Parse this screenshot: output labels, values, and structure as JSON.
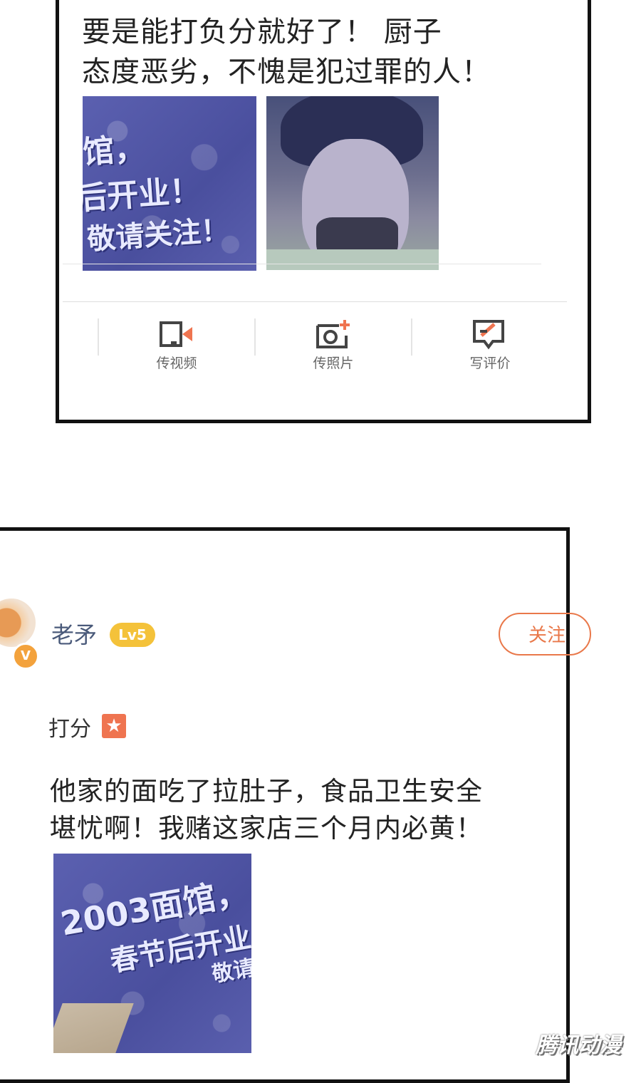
{
  "top_panel": {
    "review_text": "要是能打负分就好了！ 厨子\n态度恶劣，不愧是犯过罪的人！",
    "photo_poster_lines": [
      "馆，",
      "后开业！",
      "敬请关注！"
    ],
    "actions": [
      {
        "label": "传视频",
        "icon": "video-upload-icon"
      },
      {
        "label": "传照片",
        "icon": "photo-upload-icon"
      },
      {
        "label": "写评价",
        "icon": "write-review-icon"
      }
    ]
  },
  "bottom_panel": {
    "username": "老矛",
    "level_badge": "Lv5",
    "verified_badge": "V",
    "follow_button": "关注",
    "score_label": "打分",
    "score_star": "★",
    "review_text": "他家的面吃了拉肚子，食品卫生安全\n堪忧啊！我赌这家店三个月内必黄！",
    "photo_poster_lines": [
      "2003面馆，",
      "春节后开业",
      "敬请"
    ]
  },
  "watermark": "腾讯动漫",
  "colors": {
    "accent": "#e9784a",
    "level": "#f4c23a",
    "poster": "#4a4f9e",
    "border": "#111111"
  }
}
